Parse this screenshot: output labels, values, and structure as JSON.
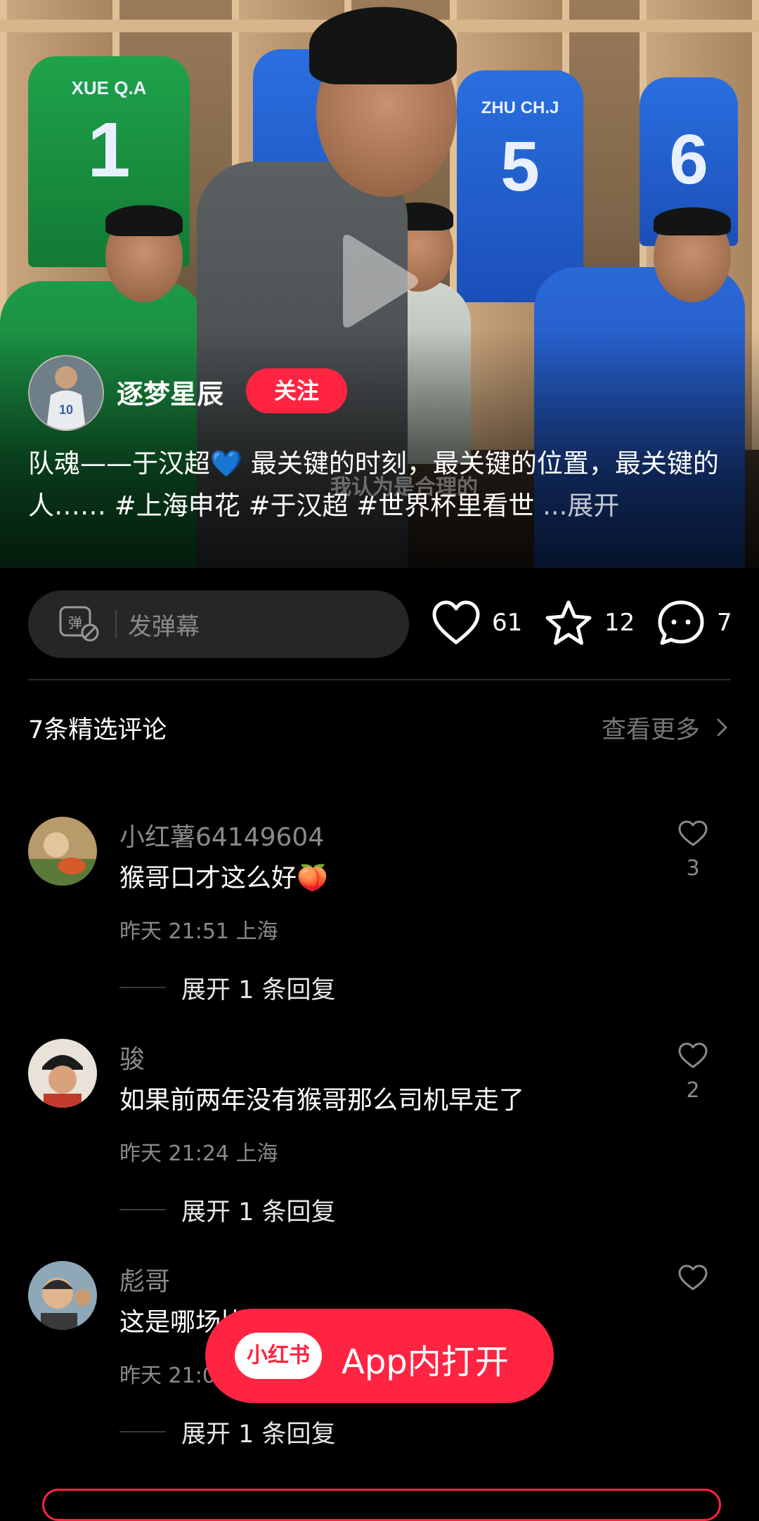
{
  "video": {
    "jersey_labels": [
      {
        "name": "XUE Q.A",
        "number": "1"
      },
      {
        "name": "ZHU CH.J",
        "number": "5"
      },
      {
        "name": "",
        "number": "6"
      }
    ],
    "subtitle": "我认为是合理的"
  },
  "author": {
    "name": "逐梦星辰",
    "follow_label": "关注"
  },
  "description": {
    "text": "队魂——于汉超💙 最关键的时刻，最关键的位置，最关键的人…… #上海申花 #于汉超 #世界杯里看世 ",
    "more_label": "...展开"
  },
  "actions": {
    "danmaku_placeholder": "发弹幕",
    "danmaku_icon_label": "弹",
    "likes": "61",
    "favorites": "12",
    "comments": "7"
  },
  "comments_section": {
    "header": "7条精选评论",
    "more_label": "查看更多",
    "items": [
      {
        "user": "小红薯64149604",
        "text": "猴哥口才这么好",
        "emoji": "🍑",
        "meta": "昨天 21:51 上海",
        "likes": "3",
        "replies_label": "展开 1 条回复"
      },
      {
        "user": "骏",
        "text": "如果前两年没有猴哥那么司机早走了",
        "emoji": "",
        "meta": "昨天 21:24 上海",
        "likes": "2",
        "replies_label": "展开 1 条回复"
      },
      {
        "user": "彪哥",
        "text": "这是哪场比赛呀，中场休息说吗",
        "emoji": "",
        "meta": "昨天 21:0",
        "likes": "",
        "replies_label": "展开 1 条回复"
      }
    ]
  },
  "open_app": {
    "logo_text": "小红书",
    "label": "App内打开"
  },
  "colors": {
    "accent": "#ff2442",
    "background": "#000000",
    "muted": "#8a8a8a"
  },
  "icons": [
    "play-icon",
    "danmaku-icon",
    "heart-icon",
    "star-icon",
    "comment-icon",
    "chevron-right-icon"
  ]
}
